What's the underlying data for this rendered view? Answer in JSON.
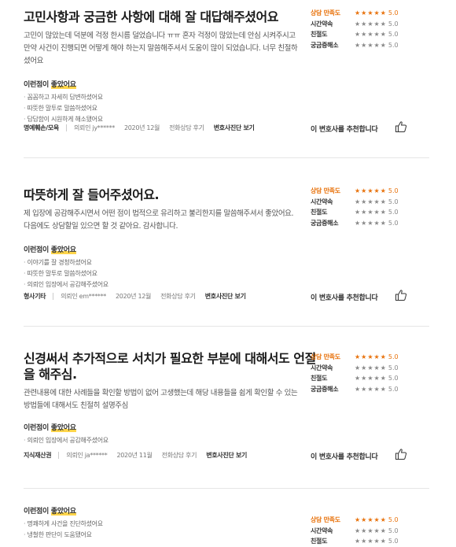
{
  "rating_labels": [
    "상담 만족도",
    "시간약속",
    "친절도",
    "궁금증해소"
  ],
  "rating_stars": "★★★★★",
  "rating_score": "5.0",
  "likes_heading_prefix": "이런점이 ",
  "likes_heading_highlight": "좋았어요",
  "recommend_text": "이 변호사를 추천합니다",
  "diagnosis_link": "변호사진단 보기",
  "colors": {
    "accent": "#e8720c",
    "highlight": "#ffd54a"
  },
  "icons": {
    "recommend": "thumbs-up-icon"
  },
  "reviews": [
    {
      "title": "고민사항과 궁금한 사항에 대해 잘 대답해주셨어요",
      "body": "고민이 많았는데 덕분에 걱정 한시름 덜었습니다 ㅠㅠ 혼자 걱정이 많았는데 안심 시켜주시고 만약 사건이 진행되면 어떻게 해야 하는지 말씀해주셔서 도움이 많이 되었습니다. 너무 친절하셨어요",
      "likes": [
        "꼼꼼하고 자세히 답변하셨어요",
        "따뜻한 말투로 말씀하셨어요",
        "답답함이 시원하게 해소됐어요"
      ],
      "category": "명예훼손/모욕",
      "user": "의뢰인 jy******",
      "date": "2020년 12월",
      "type": "전화상담 후기"
    },
    {
      "title": "따뜻하게 잘 들어주셨어요.",
      "body": "제 입장에 공감해주시면서 어떤 점이 법적으로 유리하고 불리한지를 말씀해주셔서 좋았어요. 다음에도 상담할일 있으면 할 것 같아요. 감사합니다.",
      "likes": [
        "이야기를 잘 경청하셨어요",
        "따뜻한 말투로 말씀하셨어요",
        "의뢰인 입장에서 공감해주셨어요"
      ],
      "category": "형사기타",
      "user": "의뢰인 em******",
      "date": "2020년 12월",
      "type": "전화상담 후기"
    },
    {
      "title": "신경써서 추가적으로 서치가 필요한 부분에 대해서도 언질을 해주심.",
      "body": "관련내용에 대한 사례들을 확인할 방법이 없어 고생했는데 해당 내용들을 쉽게 확인할 수 있는 방법들에 대해서도 친절히 설명주심",
      "likes": [
        "의뢰인 입장에서 공감해주셨어요"
      ],
      "category": "지식재산권",
      "user": "의뢰인 ja******",
      "date": "2020년 11월",
      "type": "전화상담 후기"
    },
    {
      "likes": [
        "명쾌하게 사건을 진단하셨어요",
        "냉철한 판단이 도움됐어요"
      ]
    }
  ]
}
